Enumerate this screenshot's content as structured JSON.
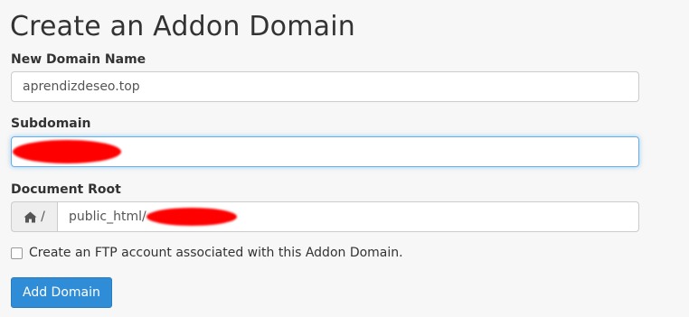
{
  "page": {
    "title": "Create an Addon Domain"
  },
  "form": {
    "new_domain": {
      "label": "New Domain Name",
      "value": "aprendizdeseo.top"
    },
    "subdomain": {
      "label": "Subdomain",
      "value": ""
    },
    "document_root": {
      "label": "Document Root",
      "prefix_icon": "home-icon",
      "prefix_text": "/",
      "value": "public_html/"
    },
    "ftp_checkbox": {
      "label": "Create an FTP account associated with this Addon Domain.",
      "checked": false
    },
    "submit_label": "Add Domain"
  },
  "colors": {
    "primary_button": "#2f8dd8",
    "focus_border": "#66afe9",
    "redaction": "#ff0000"
  }
}
